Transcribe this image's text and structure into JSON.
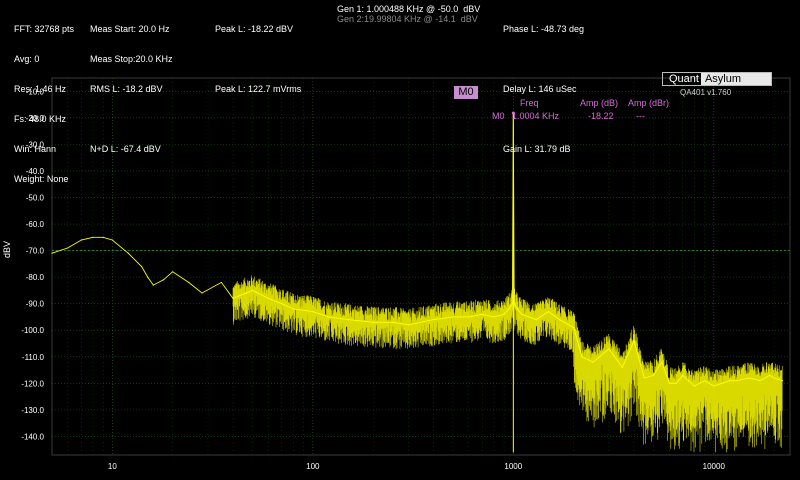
{
  "header": {
    "col1": [
      "FFT: 32768 pts",
      "Avg: 0",
      "Res: 1.46 Hz",
      "Fs: 48.0 KHz",
      "Win: Hann",
      "Weight: None"
    ],
    "col2": [
      "Meas Start: 20.0 Hz",
      "Meas Stop:20.0 KHz",
      "RMS L: -18.2 dBV",
      "",
      "N+D L: -67.4 dBV"
    ],
    "col3": [
      "Peak L: -18.22 dBV",
      "",
      "Peak L: 122.7 mVrms"
    ],
    "gen1": "Gen 1: 1.000488 KHz @ -50.0  dBV",
    "gen2": "Gen 2:19.99804 KHz @ -14.1  dBV",
    "col5": [
      "Phase L: -48.73 deg",
      "",
      "Delay L: 146 uSec",
      "",
      "Gain L: 31.79 dB"
    ]
  },
  "logo": {
    "left": "Quant",
    "right": "Asylum"
  },
  "version": "QA401 v1.760",
  "marker": {
    "tag": "M0",
    "headers": [
      "Freq",
      "Amp (dB)",
      "Amp (dBr)"
    ],
    "row": [
      "M0",
      "1.0004 KHz",
      "-18.22",
      "---"
    ]
  },
  "colors": {
    "trace": "#ffff00",
    "grid": "#1d5a1d",
    "marker": "#d96bd9",
    "background": "#000000"
  },
  "chart_data": {
    "type": "line",
    "title": "",
    "xlabel": "",
    "ylabel": "dBV",
    "x_scale": "log",
    "xlim": [
      5,
      24000
    ],
    "ylim": [
      -147,
      -5
    ],
    "x_ticks": [
      10,
      100,
      1000,
      10000
    ],
    "x_tick_labels": [
      "10",
      "100",
      "1000",
      "10000"
    ],
    "y_ticks": [
      -10,
      -20,
      -30,
      -40,
      -50,
      -60,
      -70,
      -80,
      -90,
      -100,
      -110,
      -120,
      -130,
      -140
    ],
    "y_tick_labels": [
      "-10.0",
      "-20.0",
      "-30.0",
      "-40.0",
      "-50.0",
      "-60.0",
      "-70.0",
      "-80.0",
      "-90.0",
      "-100.0",
      "-110.0",
      "-120.0",
      "-130.0",
      "-140.0"
    ],
    "reference_line_dbv": -70,
    "grid": true,
    "series": [
      {
        "x": [
          5,
          6,
          7,
          8,
          9,
          10,
          12,
          14,
          15,
          16,
          18,
          20,
          24,
          28,
          35,
          40,
          50,
          60,
          70,
          80,
          100,
          120,
          150,
          200,
          250,
          300,
          400,
          500,
          600,
          700,
          800,
          900,
          950,
          990,
          1000.4,
          1010,
          1050,
          1100,
          1300,
          1500,
          1700,
          2000,
          2200,
          2500,
          3000,
          3500,
          4000,
          4500,
          5000,
          5500,
          6000,
          6500,
          7000,
          7500,
          8000,
          9000,
          10000,
          11000,
          12000,
          13000,
          15000,
          17000,
          19000,
          20000,
          22000
        ],
        "y": [
          -71,
          -69,
          -66,
          -65,
          -65,
          -66,
          -71,
          -76,
          -80,
          -83,
          -81,
          -78,
          -82,
          -86,
          -82,
          -88,
          -85,
          -88,
          -90,
          -92,
          -93,
          -95,
          -96,
          -97,
          -97,
          -98,
          -96,
          -95,
          -95,
          -94,
          -95,
          -94,
          -92,
          -90,
          -18.22,
          -90,
          -92,
          -94,
          -96,
          -93,
          -96,
          -99,
          -110,
          -112,
          -107,
          -114,
          -104,
          -118,
          -117,
          -112,
          -120,
          -120,
          -117,
          -119,
          -121,
          -119,
          -121,
          -120,
          -119,
          -119,
          -118,
          -119,
          -117,
          -118,
          -119
        ]
      }
    ],
    "markers": [
      {
        "name": "M0",
        "x": 1000.4,
        "y": -18.22
      }
    ]
  }
}
